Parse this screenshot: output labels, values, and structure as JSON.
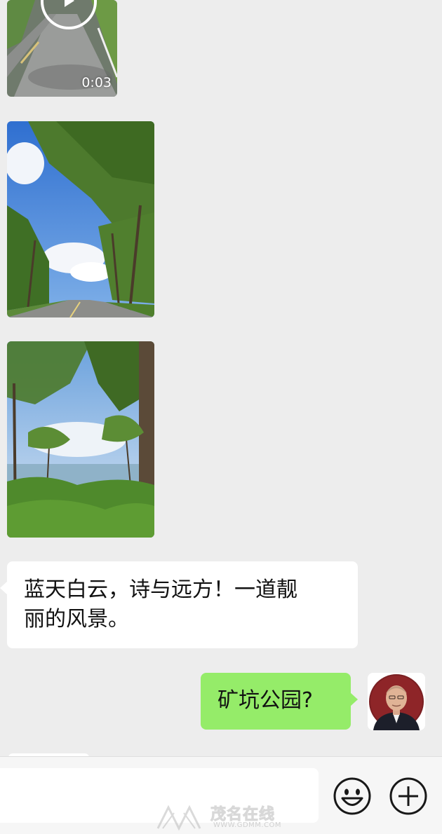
{
  "messages": [
    {
      "type": "video",
      "sender": "contact",
      "duration": "0:03"
    },
    {
      "type": "image",
      "sender": "contact",
      "subject": "tree-lined road under blue sky"
    },
    {
      "type": "image",
      "sender": "contact",
      "subject": "trees by a lake"
    },
    {
      "type": "text",
      "sender": "contact",
      "line1": "蓝天白云，诗与远方！一道靓",
      "line2": "丽的风景。"
    },
    {
      "type": "text",
      "sender": "me",
      "text": "矿坑公园?"
    }
  ],
  "input_bar": {
    "placeholder": "",
    "emoji_icon": "emoji-icon",
    "plus_icon": "plus-circle-icon"
  },
  "watermark": {
    "brand": "茂名在线",
    "url": "WWW.GDMM.COM"
  },
  "colors": {
    "background": "#ededed",
    "incoming_bubble": "#ffffff",
    "outgoing_bubble": "#95ec69"
  }
}
